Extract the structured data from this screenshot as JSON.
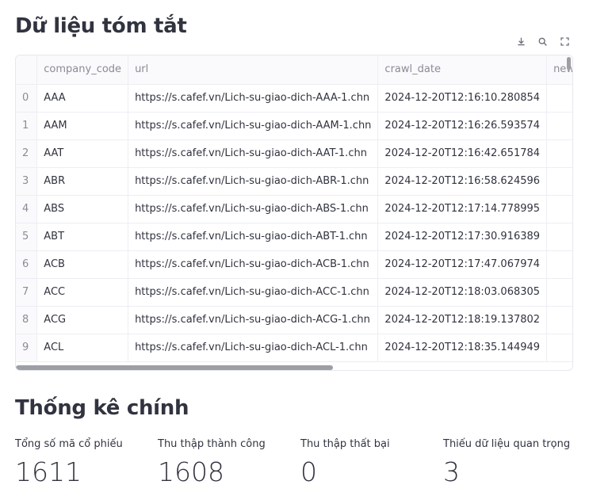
{
  "summary": {
    "title": "Dữ liệu tóm tắt",
    "columns": [
      "",
      "company_code",
      "url",
      "crawl_date",
      "new_missin"
    ],
    "rows": [
      {
        "index": "0",
        "company_code": "AAA",
        "url": "https://s.cafef.vn/Lich-su-giao-dich-AAA-1.chn",
        "crawl_date": "2024-12-20T12:16:10.280854",
        "new_missing": ""
      },
      {
        "index": "1",
        "company_code": "AAM",
        "url": "https://s.cafef.vn/Lich-su-giao-dich-AAM-1.chn",
        "crawl_date": "2024-12-20T12:16:26.593574",
        "new_missing": ""
      },
      {
        "index": "2",
        "company_code": "AAT",
        "url": "https://s.cafef.vn/Lich-su-giao-dich-AAT-1.chn",
        "crawl_date": "2024-12-20T12:16:42.651784",
        "new_missing": ""
      },
      {
        "index": "3",
        "company_code": "ABR",
        "url": "https://s.cafef.vn/Lich-su-giao-dich-ABR-1.chn",
        "crawl_date": "2024-12-20T12:16:58.624596",
        "new_missing": ""
      },
      {
        "index": "4",
        "company_code": "ABS",
        "url": "https://s.cafef.vn/Lich-su-giao-dich-ABS-1.chn",
        "crawl_date": "2024-12-20T12:17:14.778995",
        "new_missing": ""
      },
      {
        "index": "5",
        "company_code": "ABT",
        "url": "https://s.cafef.vn/Lich-su-giao-dich-ABT-1.chn",
        "crawl_date": "2024-12-20T12:17:30.916389",
        "new_missing": ""
      },
      {
        "index": "6",
        "company_code": "ACB",
        "url": "https://s.cafef.vn/Lich-su-giao-dich-ACB-1.chn",
        "crawl_date": "2024-12-20T12:17:47.067974",
        "new_missing": ""
      },
      {
        "index": "7",
        "company_code": "ACC",
        "url": "https://s.cafef.vn/Lich-su-giao-dich-ACC-1.chn",
        "crawl_date": "2024-12-20T12:18:03.068305",
        "new_missing": ""
      },
      {
        "index": "8",
        "company_code": "ACG",
        "url": "https://s.cafef.vn/Lich-su-giao-dich-ACG-1.chn",
        "crawl_date": "2024-12-20T12:18:19.137802",
        "new_missing": ""
      },
      {
        "index": "9",
        "company_code": "ACL",
        "url": "https://s.cafef.vn/Lich-su-giao-dich-ACL-1.chn",
        "crawl_date": "2024-12-20T12:18:35.144949",
        "new_missing": ""
      }
    ]
  },
  "toolbar": {
    "icons": [
      "download-icon",
      "search-icon",
      "fullscreen-icon"
    ]
  },
  "stats": {
    "title": "Thống kê chính",
    "metrics": [
      {
        "label": "Tổng số mã cổ phiếu",
        "value": "1611"
      },
      {
        "label": "Thu thập thành công",
        "value": "1608"
      },
      {
        "label": "Thu thập thất bại",
        "value": "0"
      },
      {
        "label": "Thiếu dữ liệu quan trọng",
        "value": "3"
      }
    ]
  }
}
